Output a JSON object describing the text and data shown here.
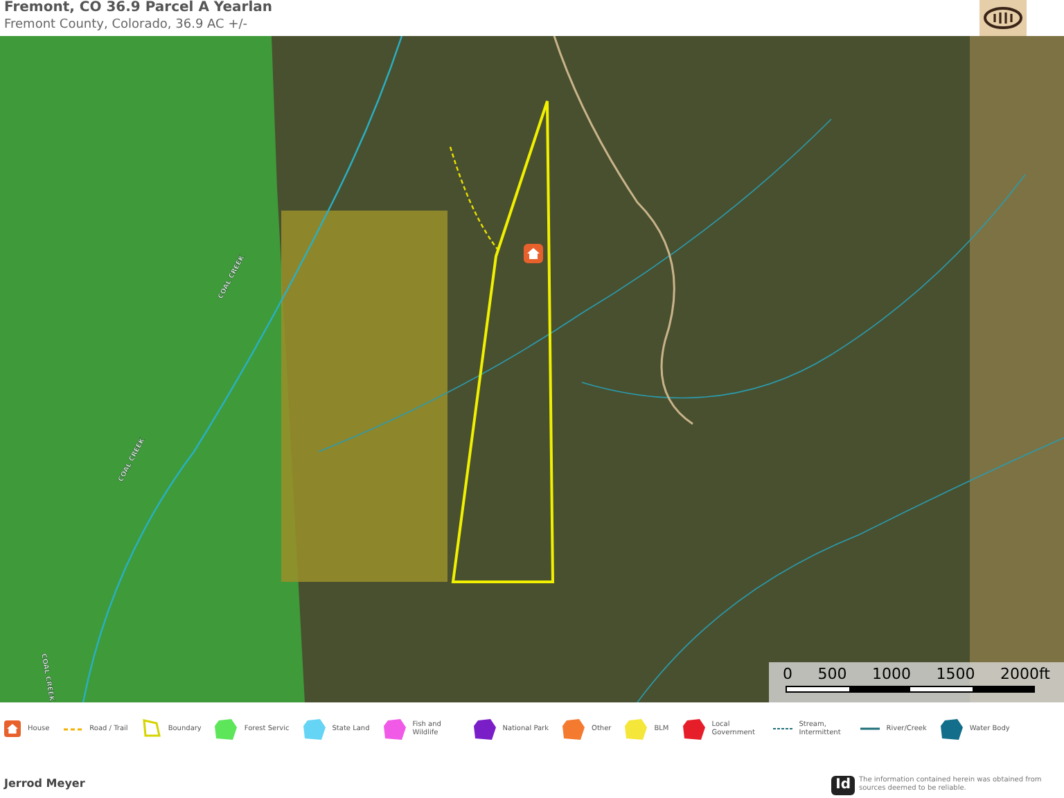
{
  "header": {
    "title": "Fremont, CO 36.9 Parcel A Yearlan",
    "subtitle": "Fremont County, Colorado, 36.9 AC +/-"
  },
  "map": {
    "labels": [
      {
        "text": "COAL CREEK"
      },
      {
        "text": "COAL CREEK"
      },
      {
        "text": "COAL CREEK"
      }
    ],
    "scale": {
      "ticks": [
        "0",
        "500",
        "1000",
        "1500",
        "2000ft"
      ]
    }
  },
  "legend": [
    {
      "kind": "house",
      "label": "House",
      "color": "#e8612c"
    },
    {
      "kind": "road",
      "label": "Road / Trail",
      "color": "#f0b400"
    },
    {
      "kind": "outline",
      "label": "Boundary",
      "color": "#d4d400"
    },
    {
      "kind": "area",
      "label": "Forest Servic",
      "color": "#5ee65a"
    },
    {
      "kind": "area",
      "label": "State Land",
      "color": "#66d4f5"
    },
    {
      "kind": "area",
      "label": "Fish and Wildlife",
      "color": "#f05ae6"
    },
    {
      "kind": "area",
      "label": "National Park",
      "color": "#7a1fc8"
    },
    {
      "kind": "area",
      "label": "Other",
      "color": "#f47a30"
    },
    {
      "kind": "area",
      "label": "BLM",
      "color": "#f5e63a"
    },
    {
      "kind": "area",
      "label": "Local Government",
      "color": "#e61e2a"
    },
    {
      "kind": "stream",
      "label": "Stream, Intermittent",
      "color": "#1f6e7a"
    },
    {
      "kind": "river",
      "label": "River/Creek",
      "color": "#1f6e7a"
    },
    {
      "kind": "area",
      "label": "Water Body",
      "color": "#126e8a"
    }
  ],
  "footer": {
    "agent": "Jerrod Meyer",
    "logo": "Id",
    "disclaimer": "The information contained herein was obtained from sources deemed to be reliable."
  }
}
